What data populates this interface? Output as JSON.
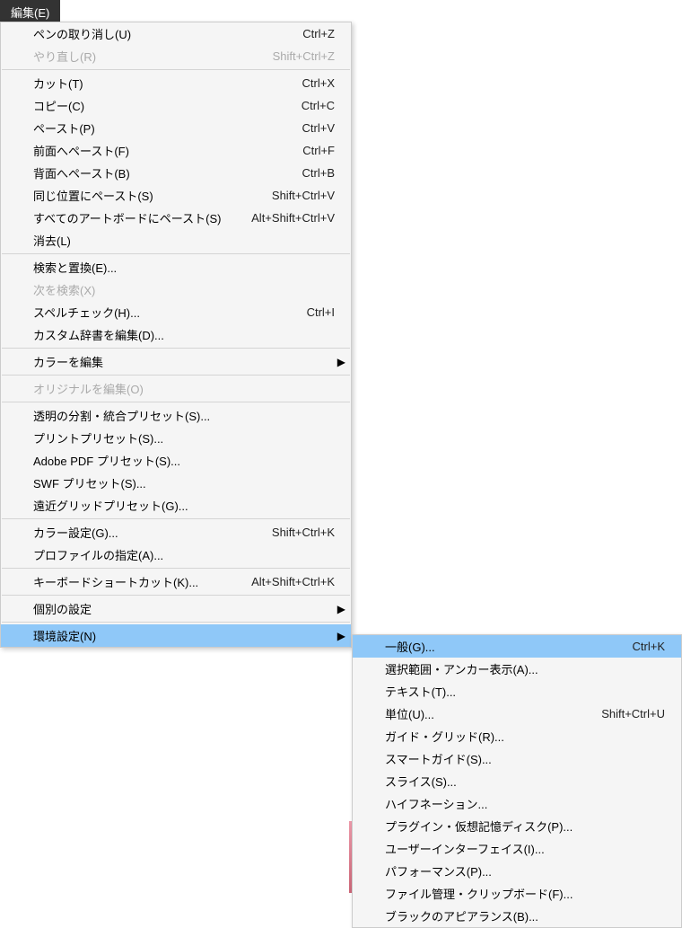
{
  "menubar": {
    "edit": "編集(E)"
  },
  "menu": {
    "undo_pen": {
      "label": "ペンの取り消し(U)",
      "shortcut": "Ctrl+Z"
    },
    "redo": {
      "label": "やり直し(R)",
      "shortcut": "Shift+Ctrl+Z",
      "disabled": true
    },
    "cut": {
      "label": "カット(T)",
      "shortcut": "Ctrl+X"
    },
    "copy": {
      "label": "コピー(C)",
      "shortcut": "Ctrl+C"
    },
    "paste": {
      "label": "ペースト(P)",
      "shortcut": "Ctrl+V"
    },
    "paste_front": {
      "label": "前面へペースト(F)",
      "shortcut": "Ctrl+F"
    },
    "paste_back": {
      "label": "背面へペースト(B)",
      "shortcut": "Ctrl+B"
    },
    "paste_in_place": {
      "label": "同じ位置にペースト(S)",
      "shortcut": "Shift+Ctrl+V"
    },
    "paste_all_ab": {
      "label": "すべてのアートボードにペースト(S)",
      "shortcut": "Alt+Shift+Ctrl+V"
    },
    "clear": {
      "label": "消去(L)"
    },
    "find_replace": {
      "label": "検索と置換(E)..."
    },
    "find_next": {
      "label": "次を検索(X)",
      "disabled": true
    },
    "spellcheck": {
      "label": "スペルチェック(H)...",
      "shortcut": "Ctrl+I"
    },
    "edit_dict": {
      "label": "カスタム辞書を編集(D)..."
    },
    "edit_colors": {
      "label": "カラーを編集",
      "submenu": true
    },
    "edit_original": {
      "label": "オリジナルを編集(O)",
      "disabled": true
    },
    "trans_preset": {
      "label": "透明の分割・統合プリセット(S)..."
    },
    "print_preset": {
      "label": "プリントプリセット(S)..."
    },
    "pdf_preset": {
      "label": "Adobe PDF プリセット(S)..."
    },
    "swf_preset": {
      "label": "SWF プリセット(S)..."
    },
    "persp_preset": {
      "label": "遠近グリッドプリセット(G)..."
    },
    "color_settings": {
      "label": "カラー設定(G)...",
      "shortcut": "Shift+Ctrl+K"
    },
    "assign_profile": {
      "label": "プロファイルの指定(A)..."
    },
    "kbd_shortcuts": {
      "label": "キーボードショートカット(K)...",
      "shortcut": "Alt+Shift+Ctrl+K"
    },
    "my_settings": {
      "label": "個別の設定",
      "submenu": true
    },
    "preferences": {
      "label": "環境設定(N)",
      "submenu": true,
      "selected": true
    }
  },
  "submenu": {
    "general": {
      "label": "一般(G)...",
      "shortcut": "Ctrl+K",
      "selected": true
    },
    "sel_anchor": {
      "label": "選択範囲・アンカー表示(A)..."
    },
    "text": {
      "label": "テキスト(T)..."
    },
    "units": {
      "label": "単位(U)...",
      "shortcut": "Shift+Ctrl+U"
    },
    "guides_grid": {
      "label": "ガイド・グリッド(R)..."
    },
    "smart_guides": {
      "label": "スマートガイド(S)..."
    },
    "slices": {
      "label": "スライス(S)..."
    },
    "hyphenation": {
      "label": "ハイフネーション..."
    },
    "plugins_scratch": {
      "label": "プラグイン・仮想記憶ディスク(P)..."
    },
    "ui": {
      "label": "ユーザーインターフェイス(I)..."
    },
    "performance": {
      "label": "パフォーマンス(P)..."
    },
    "file_clip": {
      "label": "ファイル管理・クリップボード(F)..."
    },
    "black_appear": {
      "label": "ブラックのアピアランス(B)..."
    }
  }
}
